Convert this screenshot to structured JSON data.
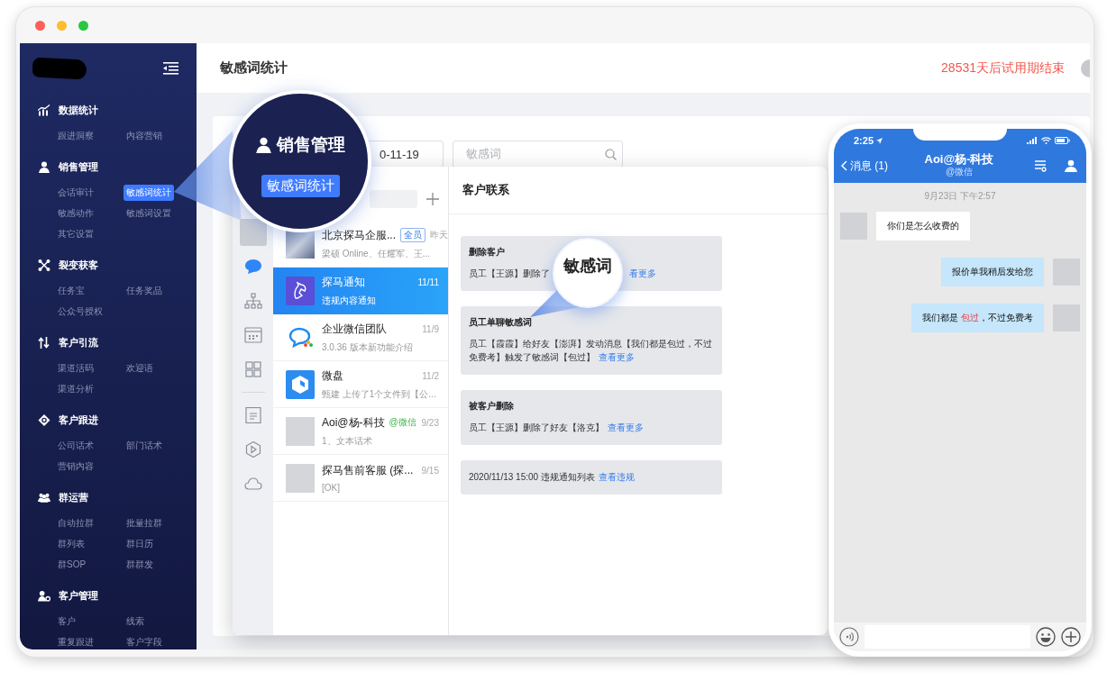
{
  "sidebar": {
    "sections": [
      {
        "title": "数据统计",
        "kind": "chart",
        "items": [
          {
            "label": "跟进洞察",
            "selected": false
          },
          {
            "label": "内容营销",
            "selected": false
          }
        ]
      },
      {
        "title": "销售管理",
        "kind": "person",
        "items": [
          {
            "label": "会话审计",
            "selected": false
          },
          {
            "label": "敏感词统计",
            "selected": true
          },
          {
            "label": "敏感动作",
            "selected": false
          },
          {
            "label": "敏感词设置",
            "selected": false
          },
          {
            "label": "其它设置",
            "selected": false
          }
        ]
      },
      {
        "title": "裂变获客",
        "kind": "fission",
        "items": [
          {
            "label": "任务宝",
            "selected": false
          },
          {
            "label": "任务奖品",
            "selected": false
          },
          {
            "label": "公众号授权",
            "selected": false
          }
        ]
      },
      {
        "title": "客户引流",
        "kind": "flow",
        "items": [
          {
            "label": "渠道活码",
            "selected": false
          },
          {
            "label": "欢迎语",
            "selected": false
          },
          {
            "label": "渠道分析",
            "selected": false
          }
        ]
      },
      {
        "title": "客户跟进",
        "kind": "target",
        "items": [
          {
            "label": "公司话术",
            "selected": false
          },
          {
            "label": "部门话术",
            "selected": false
          },
          {
            "label": "营销内容",
            "selected": false
          }
        ]
      },
      {
        "title": "群运营",
        "kind": "group",
        "items": [
          {
            "label": "自动拉群",
            "selected": false
          },
          {
            "label": "批量拉群",
            "selected": false
          },
          {
            "label": "群列表",
            "selected": false
          },
          {
            "label": "群日历",
            "selected": false
          },
          {
            "label": "群SOP",
            "selected": false
          },
          {
            "label": "群群发",
            "selected": false
          }
        ]
      },
      {
        "title": "客户管理",
        "kind": "customer",
        "items": [
          {
            "label": "客户",
            "selected": false
          },
          {
            "label": "线索",
            "selected": false
          },
          {
            "label": "重复跟进",
            "selected": false
          },
          {
            "label": "客户字段",
            "selected": false
          }
        ]
      }
    ]
  },
  "header": {
    "title": "敏感词统计",
    "trial_notice": "28531天后试用期结束"
  },
  "filters": {
    "date": "0-11-19",
    "search_placeholder": "敏感词"
  },
  "magnifier": {
    "section": "销售管理",
    "item": "敏感词统计"
  },
  "client": {
    "rail": [
      {
        "kind": "avatar",
        "selected": false
      },
      {
        "kind": "chat",
        "selected": true
      },
      {
        "kind": "org",
        "selected": false
      },
      {
        "kind": "calendar",
        "selected": false
      },
      {
        "kind": "apps",
        "selected": false
      },
      {
        "kind": "doc",
        "selected": false
      },
      {
        "kind": "hexplay",
        "selected": false
      },
      {
        "kind": "cloud",
        "selected": false
      }
    ],
    "chats": [
      {
        "name": "北京探马企服...",
        "tag": {
          "text": "全员",
          "kind": "badge"
        },
        "time": "昨天",
        "preview": "梁硕 Online、任耀军、王...",
        "kind": "group",
        "selected": false
      },
      {
        "name": "探马通知",
        "time": "11/11",
        "preview": "违规内容通知",
        "kind": "horse",
        "selected": true
      },
      {
        "name": "企业微信团队",
        "time": "11/9",
        "preview": "3.0.36 版本新功能介绍",
        "kind": "bubbles",
        "selected": false
      },
      {
        "name": "微盘",
        "time": "11/2",
        "preview": "甄建 上传了1个文件到【公...",
        "kind": "drive",
        "selected": false
      },
      {
        "name": "Aoi@杨-科技",
        "tag": {
          "text": "@微信",
          "kind": "source"
        },
        "time": "9/23",
        "preview": "1、文本话术",
        "kind": "photo",
        "selected": false
      },
      {
        "name": "探马售前客服 (探...",
        "time": "9/15",
        "preview": "[OK]",
        "kind": "photo",
        "selected": false
      }
    ],
    "panel": {
      "title": "客户联系",
      "cards": [
        {
          "title": "删除客户",
          "body": "员工【王源】删除了",
          "link": "看更多"
        },
        {
          "title": "员工单聊敏感词",
          "body": "员工【霞霞】给好友【澎湃】发动消息【我们都是包过，不过免费考】触发了敏感词【包过】",
          "link": "查看更多"
        },
        {
          "title": "被客户删除",
          "body": "员工【王源】删除了好友【洛克】",
          "link": "查看更多"
        },
        {
          "body": "2020/11/13 15:00 违规通知列表",
          "link": "查看违规"
        }
      ]
    }
  },
  "lens": {
    "text": "敏感词"
  },
  "phone": {
    "time": "2:25",
    "back": "消息 (1)",
    "title": "Aoi@杨-科技",
    "subtitle": "@微信",
    "timestamp": "9月23日 下午2:57",
    "messages": [
      {
        "kind": "incoming",
        "segments": [
          {
            "text": "你们是怎么收费的",
            "sensitive": false
          }
        ]
      },
      {
        "kind": "outgoing",
        "segments": [
          {
            "text": "报价单我稍后发给您",
            "sensitive": false
          }
        ]
      },
      {
        "kind": "outgoing",
        "segments": [
          {
            "text": "我们都是 ",
            "sensitive": false
          },
          {
            "text": "包过",
            "sensitive": true
          },
          {
            "text": "，不过免费考",
            "sensitive": false
          }
        ]
      }
    ]
  }
}
